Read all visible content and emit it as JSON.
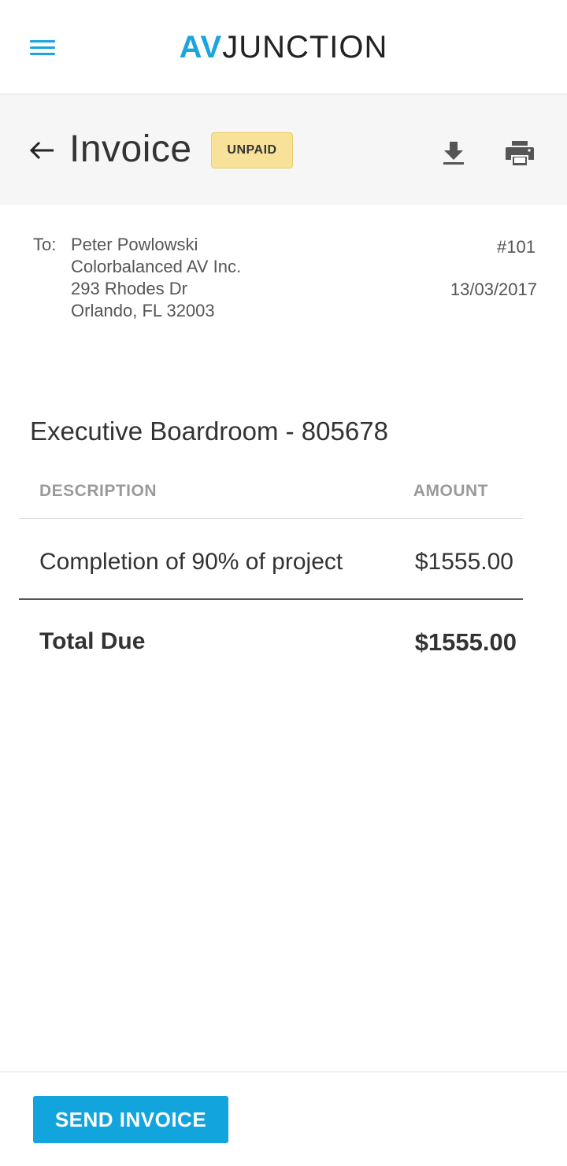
{
  "colors": {
    "brand": "#1aa6dc",
    "badge_bg": "#f8e29a",
    "button_bg": "#12a4dd"
  },
  "app_bar": {
    "menu_icon": "hamburger-menu-icon",
    "logo_av": "AV",
    "logo_junction": "JUNCTION"
  },
  "header": {
    "back_icon": "arrow-left-icon",
    "title": "Invoice",
    "status": "UNPAID",
    "download_icon": "download-icon",
    "print_icon": "print-icon"
  },
  "invoice": {
    "to_label": "To:",
    "recipient": {
      "name": "Peter Powlowski",
      "company": "Colorbalanced AV Inc.",
      "street": "293 Rhodes Dr",
      "city": "Orlando, FL 32003"
    },
    "number": "#101",
    "date": "13/03/2017",
    "project": "Executive Boardroom - 805678",
    "table": {
      "headers": {
        "description": "DESCRIPTION",
        "amount": "AMOUNT"
      },
      "rows": [
        {
          "description": "Completion of 90% of project",
          "amount": "$1555.00"
        }
      ]
    },
    "total_label": "Total Due",
    "total_amount": "$1555.00"
  },
  "footer": {
    "send_label": "SEND INVOICE"
  }
}
